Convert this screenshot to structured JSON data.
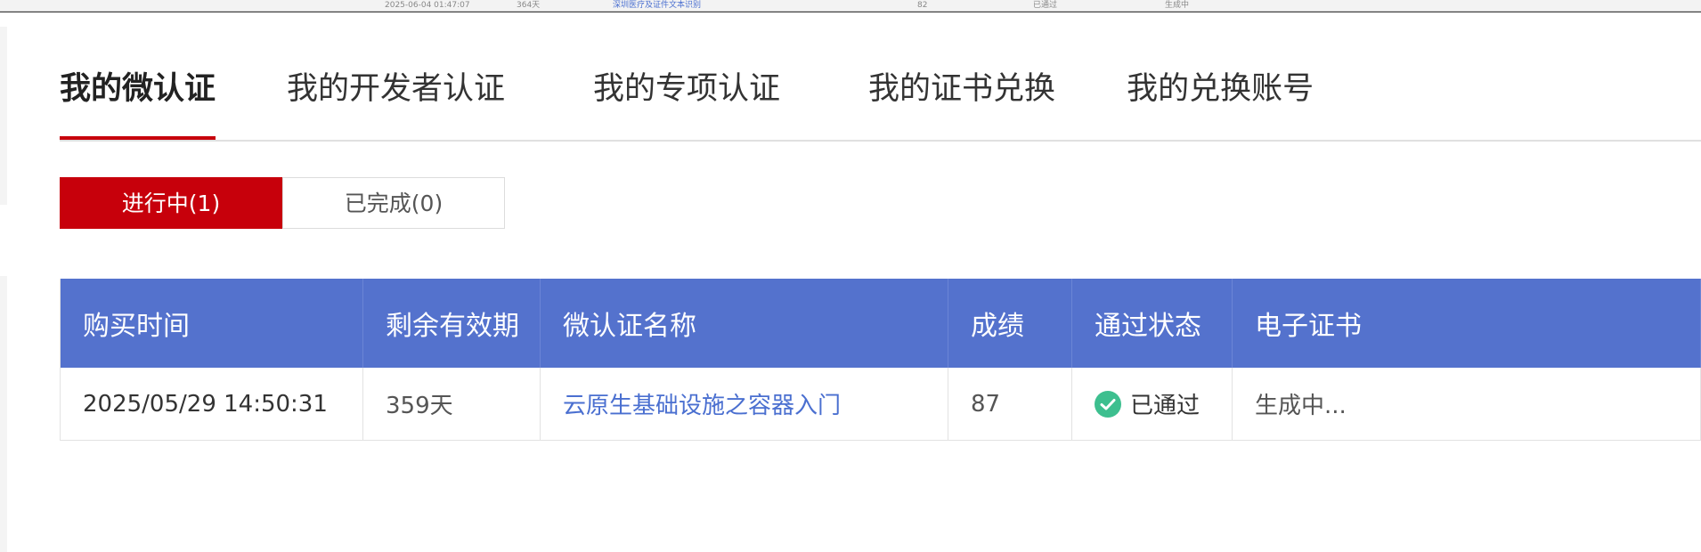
{
  "top_strip": {
    "row": [
      "2025-06-04 01:47:07",
      "364天",
      "深圳医疗及证件文本识别",
      "82",
      "已通过",
      "生成中"
    ]
  },
  "tabs": [
    {
      "label": "我的微认证",
      "active": true
    },
    {
      "label": "我的开发者认证",
      "active": false
    },
    {
      "label": "我的专项认证",
      "active": false
    },
    {
      "label": "我的证书兑换",
      "active": false
    },
    {
      "label": "我的兑换账号",
      "active": false
    }
  ],
  "segments": {
    "in_progress": "进行中(1)",
    "completed": "已完成(0)"
  },
  "table": {
    "headers": [
      "购买时间",
      "剩余有效期",
      "微认证名称",
      "成绩",
      "通过状态",
      "电子证书"
    ],
    "rows": [
      {
        "purchase_time": "2025/05/29 14:50:31",
        "remaining": "359天",
        "name": "云原生基础设施之容器入门",
        "score": "87",
        "status": "已通过",
        "certificate": "生成中..."
      }
    ]
  },
  "colors": {
    "accent_red": "#c7000b",
    "header_blue": "#5472cd",
    "link_blue": "#4a6fd0",
    "success_green": "#3dbf8f"
  }
}
